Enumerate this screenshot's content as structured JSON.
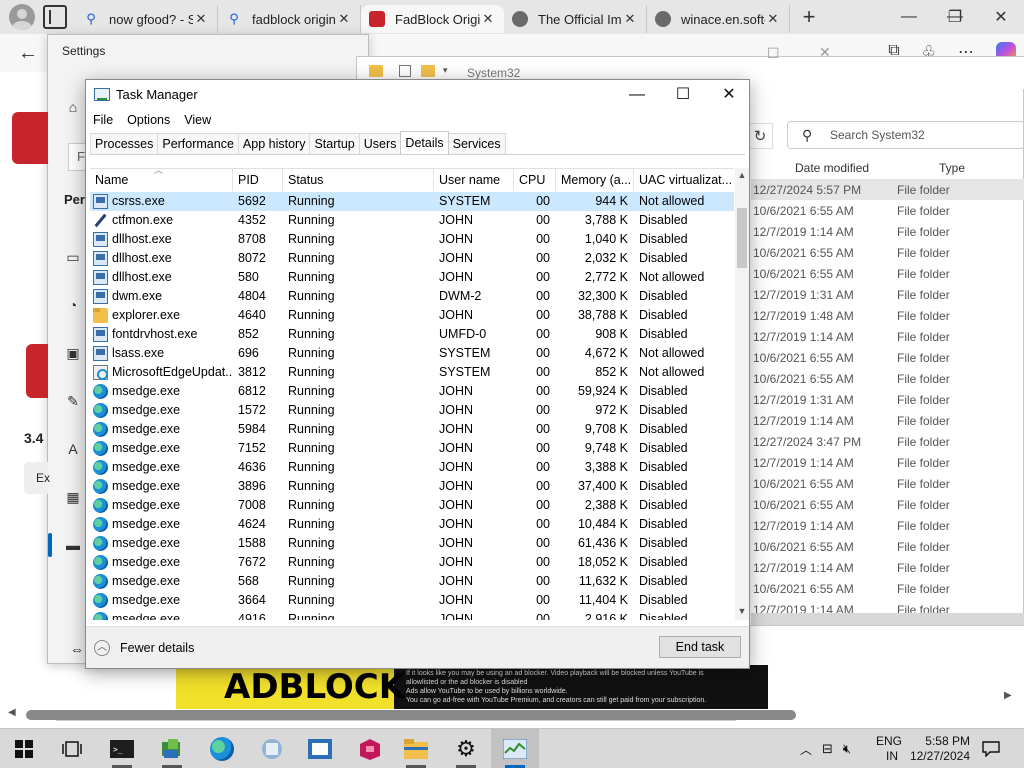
{
  "browser": {
    "tabs": [
      {
        "title": "now gfood? - S",
        "icon": "search-icon",
        "active": false
      },
      {
        "title": "fadblock origin",
        "icon": "search-icon",
        "active": false
      },
      {
        "title": "FadBlock Origin",
        "icon": "fadblock-icon",
        "active": true
      },
      {
        "title": "The Official Im",
        "icon": "site-icon",
        "active": false
      },
      {
        "title": "winace.en.softo",
        "icon": "site-icon",
        "active": false
      }
    ],
    "close_glyph": "✕",
    "new_tab_glyph": "+"
  },
  "settings": {
    "title": "Settings",
    "fragments": [
      "F",
      "Per",
      "3.4",
      "Ex"
    ]
  },
  "explorer": {
    "title": "System32",
    "search_placeholder": "Search System32",
    "columns": [
      "Date modified",
      "Type"
    ],
    "rows": [
      {
        "date": "12/27/2024 5:57 PM",
        "type": "File folder"
      },
      {
        "date": "10/6/2021 6:55 AM",
        "type": "File folder"
      },
      {
        "date": "12/7/2019 1:14 AM",
        "type": "File folder"
      },
      {
        "date": "10/6/2021 6:55 AM",
        "type": "File folder"
      },
      {
        "date": "10/6/2021 6:55 AM",
        "type": "File folder"
      },
      {
        "date": "12/7/2019 1:31 AM",
        "type": "File folder"
      },
      {
        "date": "12/7/2019 1:48 AM",
        "type": "File folder"
      },
      {
        "date": "12/7/2019 1:14 AM",
        "type": "File folder"
      },
      {
        "date": "10/6/2021 6:55 AM",
        "type": "File folder"
      },
      {
        "date": "10/6/2021 6:55 AM",
        "type": "File folder"
      },
      {
        "date": "12/7/2019 1:31 AM",
        "type": "File folder"
      },
      {
        "date": "12/7/2019 1:14 AM",
        "type": "File folder"
      },
      {
        "date": "12/27/2024 3:47 PM",
        "type": "File folder"
      },
      {
        "date": "12/7/2019 1:14 AM",
        "type": "File folder"
      },
      {
        "date": "10/6/2021 6:55 AM",
        "type": "File folder"
      },
      {
        "date": "10/6/2021 6:55 AM",
        "type": "File folder"
      },
      {
        "date": "12/7/2019 1:14 AM",
        "type": "File folder"
      },
      {
        "date": "10/6/2021 6:55 AM",
        "type": "File folder"
      },
      {
        "date": "12/7/2019 1:14 AM",
        "type": "File folder"
      },
      {
        "date": "10/6/2021 6:55 AM",
        "type": "File folder"
      },
      {
        "date": "12/7/2019 1:14 AM",
        "type": "File folder"
      }
    ]
  },
  "ad": {
    "headline": "ADBLOCK",
    "lines": [
      "If it looks like you may be using an ad blocker. Video playback will be blocked unless YouTube is",
      "allowlisted or the ad blocker is disabled",
      "Ads allow YouTube to be used by billions worldwide.",
      "You can go ad-free with YouTube Premium, and creators can still get paid from your subscription."
    ]
  },
  "taskmanager": {
    "title": "Task Manager",
    "menu": [
      "File",
      "Options",
      "View"
    ],
    "tabs": [
      "Processes",
      "Performance",
      "App history",
      "Startup",
      "Users",
      "Details",
      "Services"
    ],
    "active_tab": "Details",
    "columns": [
      "Name",
      "PID",
      "Status",
      "User name",
      "CPU",
      "Memory (a...",
      "UAC virtualizat..."
    ],
    "rows": [
      {
        "name": "csrss.exe",
        "pid": "5692",
        "status": "Running",
        "user": "SYSTEM",
        "cpu": "00",
        "mem": "944 K",
        "uac": "Not allowed",
        "icon": "system-process-icon"
      },
      {
        "name": "ctfmon.exe",
        "pid": "4352",
        "status": "Running",
        "user": "JOHN",
        "cpu": "00",
        "mem": "3,788 K",
        "uac": "Disabled",
        "icon": "pen-icon"
      },
      {
        "name": "dllhost.exe",
        "pid": "8708",
        "status": "Running",
        "user": "JOHN",
        "cpu": "00",
        "mem": "1,040 K",
        "uac": "Disabled",
        "icon": "system-process-icon"
      },
      {
        "name": "dllhost.exe",
        "pid": "8072",
        "status": "Running",
        "user": "JOHN",
        "cpu": "00",
        "mem": "2,032 K",
        "uac": "Disabled",
        "icon": "system-process-icon"
      },
      {
        "name": "dllhost.exe",
        "pid": "580",
        "status": "Running",
        "user": "JOHN",
        "cpu": "00",
        "mem": "2,772 K",
        "uac": "Not allowed",
        "icon": "system-process-icon"
      },
      {
        "name": "dwm.exe",
        "pid": "4804",
        "status": "Running",
        "user": "DWM-2",
        "cpu": "00",
        "mem": "32,300 K",
        "uac": "Disabled",
        "icon": "system-process-icon"
      },
      {
        "name": "explorer.exe",
        "pid": "4640",
        "status": "Running",
        "user": "JOHN",
        "cpu": "00",
        "mem": "38,788 K",
        "uac": "Disabled",
        "icon": "folder-icon"
      },
      {
        "name": "fontdrvhost.exe",
        "pid": "852",
        "status": "Running",
        "user": "UMFD-0",
        "cpu": "00",
        "mem": "908 K",
        "uac": "Disabled",
        "icon": "system-process-icon"
      },
      {
        "name": "lsass.exe",
        "pid": "696",
        "status": "Running",
        "user": "SYSTEM",
        "cpu": "00",
        "mem": "4,672 K",
        "uac": "Not allowed",
        "icon": "system-process-icon"
      },
      {
        "name": "MicrosoftEdgeUpdat...",
        "pid": "3812",
        "status": "Running",
        "user": "SYSTEM",
        "cpu": "00",
        "mem": "852 K",
        "uac": "Not allowed",
        "icon": "edge-update-icon"
      },
      {
        "name": "msedge.exe",
        "pid": "6812",
        "status": "Running",
        "user": "JOHN",
        "cpu": "00",
        "mem": "59,924 K",
        "uac": "Disabled",
        "icon": "edge-icon"
      },
      {
        "name": "msedge.exe",
        "pid": "1572",
        "status": "Running",
        "user": "JOHN",
        "cpu": "00",
        "mem": "972 K",
        "uac": "Disabled",
        "icon": "edge-icon"
      },
      {
        "name": "msedge.exe",
        "pid": "5984",
        "status": "Running",
        "user": "JOHN",
        "cpu": "00",
        "mem": "9,708 K",
        "uac": "Disabled",
        "icon": "edge-icon"
      },
      {
        "name": "msedge.exe",
        "pid": "7152",
        "status": "Running",
        "user": "JOHN",
        "cpu": "00",
        "mem": "9,748 K",
        "uac": "Disabled",
        "icon": "edge-icon"
      },
      {
        "name": "msedge.exe",
        "pid": "4636",
        "status": "Running",
        "user": "JOHN",
        "cpu": "00",
        "mem": "3,388 K",
        "uac": "Disabled",
        "icon": "edge-icon"
      },
      {
        "name": "msedge.exe",
        "pid": "3896",
        "status": "Running",
        "user": "JOHN",
        "cpu": "00",
        "mem": "37,400 K",
        "uac": "Disabled",
        "icon": "edge-icon"
      },
      {
        "name": "msedge.exe",
        "pid": "7008",
        "status": "Running",
        "user": "JOHN",
        "cpu": "00",
        "mem": "2,388 K",
        "uac": "Disabled",
        "icon": "edge-icon"
      },
      {
        "name": "msedge.exe",
        "pid": "4624",
        "status": "Running",
        "user": "JOHN",
        "cpu": "00",
        "mem": "10,484 K",
        "uac": "Disabled",
        "icon": "edge-icon"
      },
      {
        "name": "msedge.exe",
        "pid": "1588",
        "status": "Running",
        "user": "JOHN",
        "cpu": "00",
        "mem": "61,436 K",
        "uac": "Disabled",
        "icon": "edge-icon"
      },
      {
        "name": "msedge.exe",
        "pid": "7672",
        "status": "Running",
        "user": "JOHN",
        "cpu": "00",
        "mem": "18,052 K",
        "uac": "Disabled",
        "icon": "edge-icon"
      },
      {
        "name": "msedge.exe",
        "pid": "568",
        "status": "Running",
        "user": "JOHN",
        "cpu": "00",
        "mem": "11,632 K",
        "uac": "Disabled",
        "icon": "edge-icon"
      },
      {
        "name": "msedge.exe",
        "pid": "3664",
        "status": "Running",
        "user": "JOHN",
        "cpu": "00",
        "mem": "11,404 K",
        "uac": "Disabled",
        "icon": "edge-icon"
      },
      {
        "name": "msedge.exe",
        "pid": "4916",
        "status": "Running",
        "user": "JOHN",
        "cpu": "00",
        "mem": "2,916 K",
        "uac": "Disabled",
        "icon": "edge-icon"
      }
    ],
    "fewer_details": "Fewer details",
    "end_task": "End task"
  },
  "taskbar": {
    "language": "ENG",
    "region": "IN",
    "time": "5:58 PM",
    "date": "12/27/2024"
  }
}
